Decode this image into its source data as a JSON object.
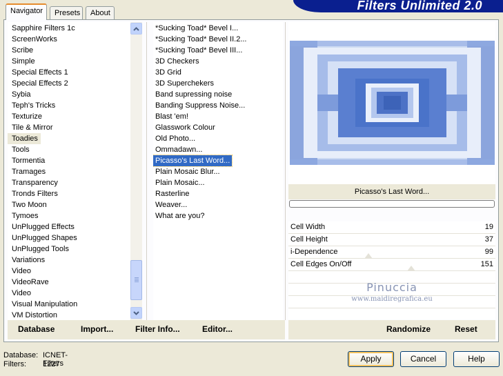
{
  "app": {
    "banner": "Filters Unlimited 2.0"
  },
  "tabs": [
    {
      "label": "Navigator",
      "active": true
    },
    {
      "label": "Presets",
      "active": false
    },
    {
      "label": "About",
      "active": false
    }
  ],
  "categories": [
    "Sapphire Filters 1c",
    "ScreenWorks",
    "Scribe",
    "Simple",
    "Special Effects 1",
    "Special Effects 2",
    "Sybia",
    "Teph's Tricks",
    "Texturize",
    "Tile & Mirror",
    "Toadies",
    "Tools",
    "Tormentia",
    "Tramages",
    "Transparency",
    "Tronds Filters",
    "Two Moon",
    "Tymoes",
    "UnPlugged Effects",
    "UnPlugged Shapes",
    "UnPlugged Tools",
    "Variations",
    "Video",
    "VideoRave",
    "Video",
    "Visual Manipulation",
    "VM Distortion"
  ],
  "selected_category": "Toadies",
  "filters": [
    "*Sucking Toad*  Bevel I...",
    "*Sucking Toad*  Bevel II.2...",
    "*Sucking Toad*  Bevel III...",
    "3D Checkers",
    "3D Grid",
    "3D Superchekers",
    "Band supressing noise",
    "Banding Suppress Noise...",
    "Blast 'em!",
    "Glasswork Colour",
    "Old Photo...",
    "Ommadawn...",
    "Picasso's Last Word...",
    "Plain Mosaic Blur...",
    "Plain Mosaic...",
    "Rasterline",
    "Weaver...",
    "What are you?"
  ],
  "selected_filter": "Picasso's Last Word...",
  "preview_title": "Picasso's Last Word...",
  "params": [
    {
      "label": "Cell Width",
      "value": "19"
    },
    {
      "label": "Cell Height",
      "value": "37"
    },
    {
      "label": "i-Dependence",
      "value": "99"
    },
    {
      "label": "Cell Edges On/Off",
      "value": "151"
    }
  ],
  "watermark": {
    "name": "Pinuccia",
    "url": "www.maidiregrafica.eu"
  },
  "strip_buttons": {
    "database": "Database",
    "import": "Import...",
    "filter_info": "Filter Info...",
    "editor": "Editor...",
    "randomize": "Randomize",
    "reset": "Reset"
  },
  "status": {
    "database_label": "Database:",
    "database_value": "ICNET-Filters",
    "filters_label": "Filters:",
    "filters_value": "1227"
  },
  "dialog_buttons": {
    "apply": "Apply",
    "cancel": "Cancel",
    "help": "Help"
  },
  "colors": {
    "banner": "#0a1f8f",
    "selection": "#316ac5",
    "preview_dark": "#4a73c9",
    "preview_light": "#dfe8f8"
  }
}
